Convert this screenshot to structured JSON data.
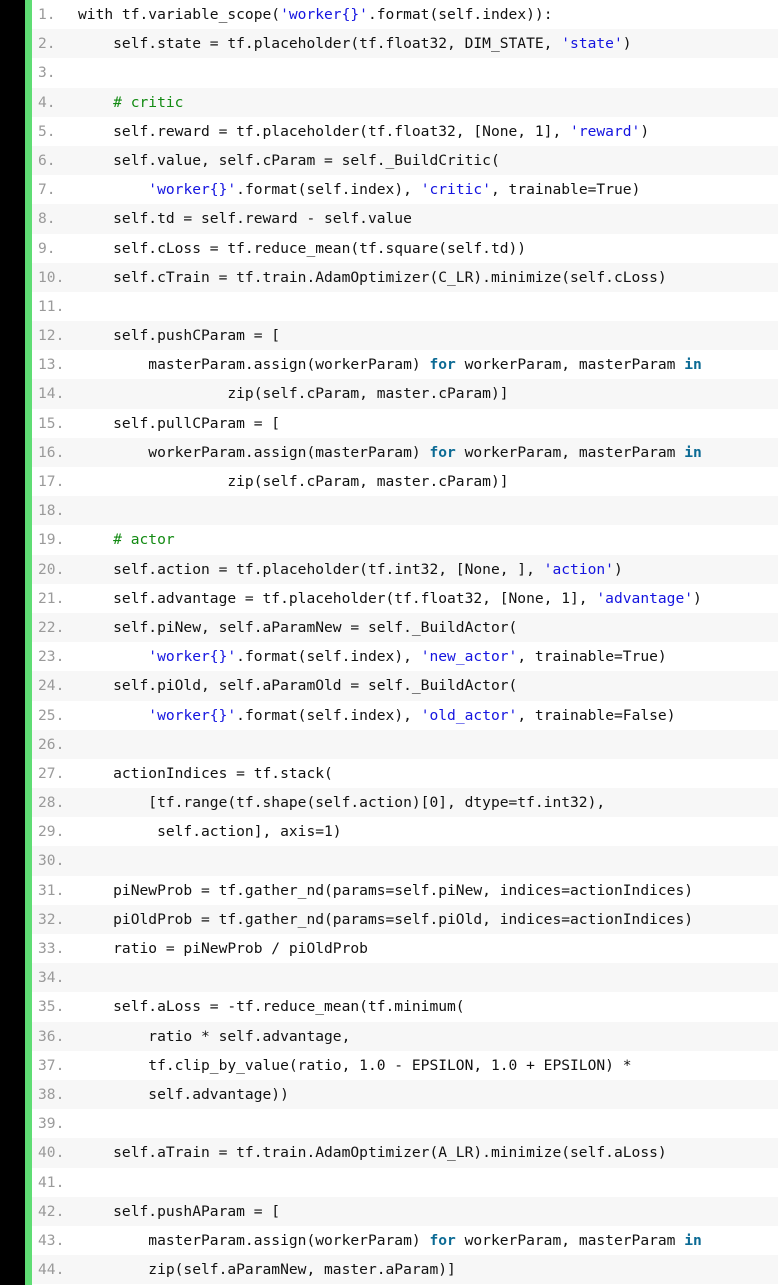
{
  "editor": {
    "language": "python",
    "gutter_color": "#000000",
    "accent_color": "#5fdd74",
    "background": "#ffffff",
    "alt_row_background": "#f7f7f7",
    "line_number_color": "#9a9a9a",
    "colors": {
      "plain": "#111111",
      "string": "#1414e0",
      "comment": "#128a12",
      "keyword": "#0b6a94"
    },
    "first_line": 1,
    "last_line": 44
  },
  "lines": [
    {
      "n": "1.",
      "tokens": [
        {
          "t": "with tf.variable_scope(",
          "c": "plain"
        },
        {
          "t": "'worker{}'",
          "c": "string"
        },
        {
          "t": ".format(self.index)):",
          "c": "plain"
        }
      ]
    },
    {
      "n": "2.",
      "tokens": [
        {
          "t": "    self.state = tf.placeholder(tf.float32, DIM_STATE, ",
          "c": "plain"
        },
        {
          "t": "'state'",
          "c": "string"
        },
        {
          "t": ")",
          "c": "plain"
        }
      ]
    },
    {
      "n": "3.",
      "tokens": [
        {
          "t": "",
          "c": "plain"
        }
      ]
    },
    {
      "n": "4.",
      "tokens": [
        {
          "t": "    # critic",
          "c": "comment"
        }
      ]
    },
    {
      "n": "5.",
      "tokens": [
        {
          "t": "    self.reward = tf.placeholder(tf.float32, [None, 1], ",
          "c": "plain"
        },
        {
          "t": "'reward'",
          "c": "string"
        },
        {
          "t": ")",
          "c": "plain"
        }
      ]
    },
    {
      "n": "6.",
      "tokens": [
        {
          "t": "    self.value, self.cParam = self._BuildCritic(",
          "c": "plain"
        }
      ]
    },
    {
      "n": "7.",
      "tokens": [
        {
          "t": "        ",
          "c": "plain"
        },
        {
          "t": "'worker{}'",
          "c": "string"
        },
        {
          "t": ".format(self.index), ",
          "c": "plain"
        },
        {
          "t": "'critic'",
          "c": "string"
        },
        {
          "t": ", trainable=True)",
          "c": "plain"
        }
      ]
    },
    {
      "n": "8.",
      "tokens": [
        {
          "t": "    self.td = self.reward - self.value",
          "c": "plain"
        }
      ]
    },
    {
      "n": "9.",
      "tokens": [
        {
          "t": "    self.cLoss = tf.reduce_mean(tf.square(self.td))",
          "c": "plain"
        }
      ]
    },
    {
      "n": "10.",
      "tokens": [
        {
          "t": "    self.cTrain = tf.train.AdamOptimizer(C_LR).minimize(self.cLoss)",
          "c": "plain"
        }
      ]
    },
    {
      "n": "11.",
      "tokens": [
        {
          "t": "",
          "c": "plain"
        }
      ]
    },
    {
      "n": "12.",
      "tokens": [
        {
          "t": "    self.pushCParam = [",
          "c": "plain"
        }
      ]
    },
    {
      "n": "13.",
      "tokens": [
        {
          "t": "        masterParam.assign(workerParam) ",
          "c": "plain"
        },
        {
          "t": "for",
          "c": "keyword"
        },
        {
          "t": " workerParam, masterParam ",
          "c": "plain"
        },
        {
          "t": "in",
          "c": "keyword"
        }
      ]
    },
    {
      "n": "14.",
      "tokens": [
        {
          "t": "                 zip(self.cParam, master.cParam)]",
          "c": "plain"
        }
      ]
    },
    {
      "n": "15.",
      "tokens": [
        {
          "t": "    self.pullCParam = [",
          "c": "plain"
        }
      ]
    },
    {
      "n": "16.",
      "tokens": [
        {
          "t": "        workerParam.assign(masterParam) ",
          "c": "plain"
        },
        {
          "t": "for",
          "c": "keyword"
        },
        {
          "t": " workerParam, masterParam ",
          "c": "plain"
        },
        {
          "t": "in",
          "c": "keyword"
        }
      ]
    },
    {
      "n": "17.",
      "tokens": [
        {
          "t": "                 zip(self.cParam, master.cParam)]",
          "c": "plain"
        }
      ]
    },
    {
      "n": "18.",
      "tokens": [
        {
          "t": "",
          "c": "plain"
        }
      ]
    },
    {
      "n": "19.",
      "tokens": [
        {
          "t": "    # actor",
          "c": "comment"
        }
      ]
    },
    {
      "n": "20.",
      "tokens": [
        {
          "t": "    self.action = tf.placeholder(tf.int32, [None, ], ",
          "c": "plain"
        },
        {
          "t": "'action'",
          "c": "string"
        },
        {
          "t": ")",
          "c": "plain"
        }
      ]
    },
    {
      "n": "21.",
      "tokens": [
        {
          "t": "    self.advantage = tf.placeholder(tf.float32, [None, 1], ",
          "c": "plain"
        },
        {
          "t": "'advantage'",
          "c": "string"
        },
        {
          "t": ")",
          "c": "plain"
        }
      ]
    },
    {
      "n": "22.",
      "tokens": [
        {
          "t": "    self.piNew, self.aParamNew = self._BuildActor(",
          "c": "plain"
        }
      ]
    },
    {
      "n": "23.",
      "tokens": [
        {
          "t": "        ",
          "c": "plain"
        },
        {
          "t": "'worker{}'",
          "c": "string"
        },
        {
          "t": ".format(self.index), ",
          "c": "plain"
        },
        {
          "t": "'new_actor'",
          "c": "string"
        },
        {
          "t": ", trainable=True)",
          "c": "plain"
        }
      ]
    },
    {
      "n": "24.",
      "tokens": [
        {
          "t": "    self.piOld, self.aParamOld = self._BuildActor(",
          "c": "plain"
        }
      ]
    },
    {
      "n": "25.",
      "tokens": [
        {
          "t": "        ",
          "c": "plain"
        },
        {
          "t": "'worker{}'",
          "c": "string"
        },
        {
          "t": ".format(self.index), ",
          "c": "plain"
        },
        {
          "t": "'old_actor'",
          "c": "string"
        },
        {
          "t": ", trainable=False)",
          "c": "plain"
        }
      ]
    },
    {
      "n": "26.",
      "tokens": [
        {
          "t": "",
          "c": "plain"
        }
      ]
    },
    {
      "n": "27.",
      "tokens": [
        {
          "t": "    actionIndices = tf.stack(",
          "c": "plain"
        }
      ]
    },
    {
      "n": "28.",
      "tokens": [
        {
          "t": "        [tf.range(tf.shape(self.action)[0], dtype=tf.int32),",
          "c": "plain"
        }
      ]
    },
    {
      "n": "29.",
      "tokens": [
        {
          "t": "         self.action], axis=1)",
          "c": "plain"
        }
      ]
    },
    {
      "n": "30.",
      "tokens": [
        {
          "t": "",
          "c": "plain"
        }
      ]
    },
    {
      "n": "31.",
      "tokens": [
        {
          "t": "    piNewProb = tf.gather_nd(params=self.piNew, indices=actionIndices)",
          "c": "plain"
        }
      ]
    },
    {
      "n": "32.",
      "tokens": [
        {
          "t": "    piOldProb = tf.gather_nd(params=self.piOld, indices=actionIndices)",
          "c": "plain"
        }
      ]
    },
    {
      "n": "33.",
      "tokens": [
        {
          "t": "    ratio = piNewProb / piOldProb",
          "c": "plain"
        }
      ]
    },
    {
      "n": "34.",
      "tokens": [
        {
          "t": "",
          "c": "plain"
        }
      ]
    },
    {
      "n": "35.",
      "tokens": [
        {
          "t": "    self.aLoss = -tf.reduce_mean(tf.minimum(",
          "c": "plain"
        }
      ]
    },
    {
      "n": "36.",
      "tokens": [
        {
          "t": "        ratio * self.advantage,",
          "c": "plain"
        }
      ]
    },
    {
      "n": "37.",
      "tokens": [
        {
          "t": "        tf.clip_by_value(ratio, 1.0 - EPSILON, 1.0 + EPSILON) *",
          "c": "plain"
        }
      ]
    },
    {
      "n": "38.",
      "tokens": [
        {
          "t": "        self.advantage))",
          "c": "plain"
        }
      ]
    },
    {
      "n": "39.",
      "tokens": [
        {
          "t": "",
          "c": "plain"
        }
      ]
    },
    {
      "n": "40.",
      "tokens": [
        {
          "t": "    self.aTrain = tf.train.AdamOptimizer(A_LR).minimize(self.aLoss)",
          "c": "plain"
        }
      ]
    },
    {
      "n": "41.",
      "tokens": [
        {
          "t": "",
          "c": "plain"
        }
      ]
    },
    {
      "n": "42.",
      "tokens": [
        {
          "t": "    self.pushAParam = [",
          "c": "plain"
        }
      ]
    },
    {
      "n": "43.",
      "tokens": [
        {
          "t": "        masterParam.assign(workerParam) ",
          "c": "plain"
        },
        {
          "t": "for",
          "c": "keyword"
        },
        {
          "t": " workerParam, masterParam ",
          "c": "plain"
        },
        {
          "t": "in",
          "c": "keyword"
        }
      ]
    },
    {
      "n": "44.",
      "tokens": [
        {
          "t": "        zip(self.aParamNew, master.aParam)]",
          "c": "plain"
        }
      ]
    }
  ]
}
